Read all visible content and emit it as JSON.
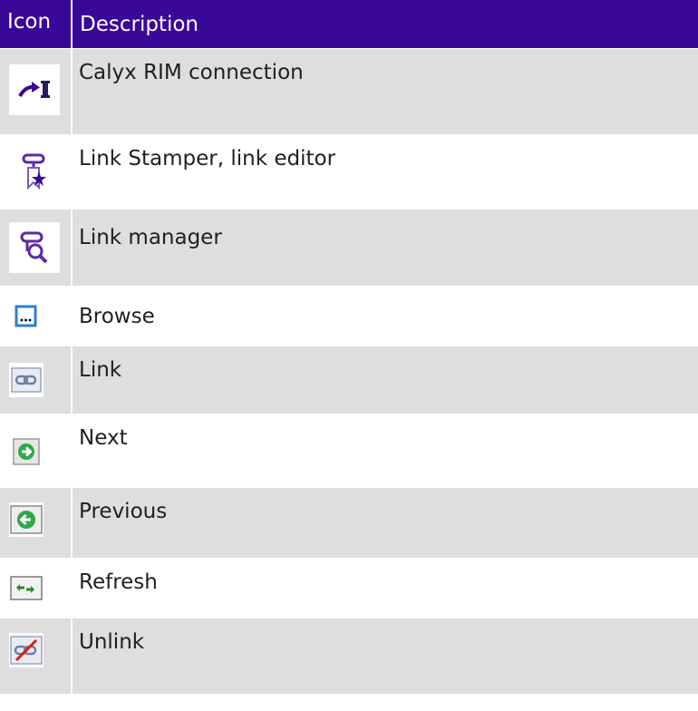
{
  "table": {
    "headers": {
      "icon": "Icon",
      "description": "Description"
    },
    "rows": [
      {
        "icon": "calyx-rim-connection-icon",
        "description": "Calyx RIM connection"
      },
      {
        "icon": "link-stamper-icon",
        "description": "Link Stamper, link editor"
      },
      {
        "icon": "link-manager-icon",
        "description": "Link manager"
      },
      {
        "icon": "browse-icon",
        "description": "Browse"
      },
      {
        "icon": "link-icon",
        "description": "Link"
      },
      {
        "icon": "next-icon",
        "description": "Next"
      },
      {
        "icon": "previous-icon",
        "description": "Previous"
      },
      {
        "icon": "refresh-icon",
        "description": "Refresh"
      },
      {
        "icon": "unlink-icon",
        "description": "Unlink"
      }
    ]
  },
  "colors": {
    "header_bg": "#3a0899",
    "row_odd": "#dedede",
    "row_even": "#ffffff"
  }
}
